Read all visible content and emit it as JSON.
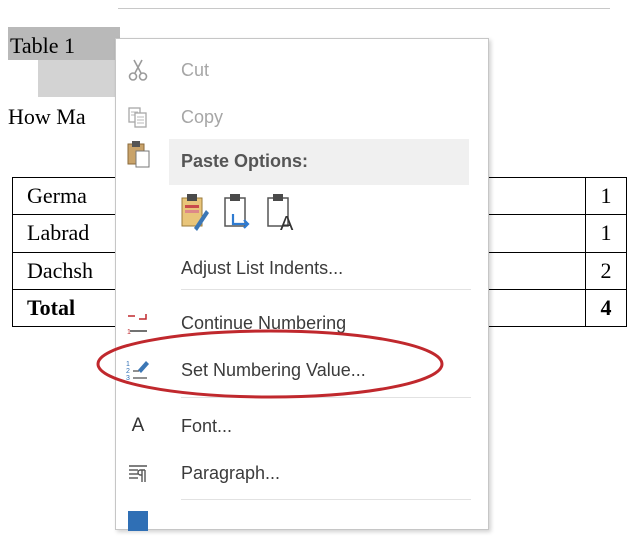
{
  "document": {
    "caption": "Table 1",
    "body_text": "How Ma",
    "table": {
      "rows": [
        {
          "name": "Germa",
          "count": "1"
        },
        {
          "name": "Labrad",
          "count": "1"
        },
        {
          "name": "Dachsh",
          "count": "2"
        },
        {
          "name": "Total",
          "count": "4"
        }
      ]
    }
  },
  "context_menu": {
    "cut": "Cut",
    "copy": "Copy",
    "paste_options": "Paste Options:",
    "adjust_list_indents": "Adjust List Indents...",
    "continue_numbering": "Continue Numbering",
    "set_numbering_value": "Set Numbering Value...",
    "font": "Font...",
    "paragraph": "Paragraph...",
    "font_icon_glyph": "A",
    "highlight_color": "#c0282d"
  }
}
